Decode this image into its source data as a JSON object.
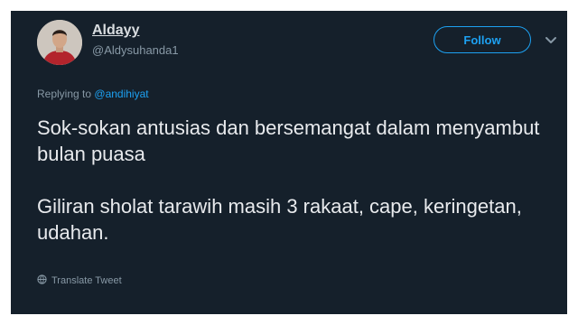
{
  "author": {
    "display_name": "Aldayy",
    "username": "@Aldysuhanda1"
  },
  "follow_button": {
    "label": "Follow"
  },
  "reply": {
    "prefix": "Replying to",
    "mention": "@andihiyat"
  },
  "tweet": {
    "paragraph_1": "Sok-sokan antusias dan bersemangat dalam menyambut bulan puasa",
    "paragraph_2": "Giliran sholat tarawih masih 3 rakaat, cape, keringetan, udahan."
  },
  "translate": {
    "label": "Translate Tweet"
  },
  "colors": {
    "background": "#15202b",
    "accent": "#1da1f2",
    "muted_text": "#8899a6",
    "primary_text": "#e8eaed"
  },
  "icons": {
    "chevron": "chevron-down-icon",
    "translate": "globe-icon"
  }
}
